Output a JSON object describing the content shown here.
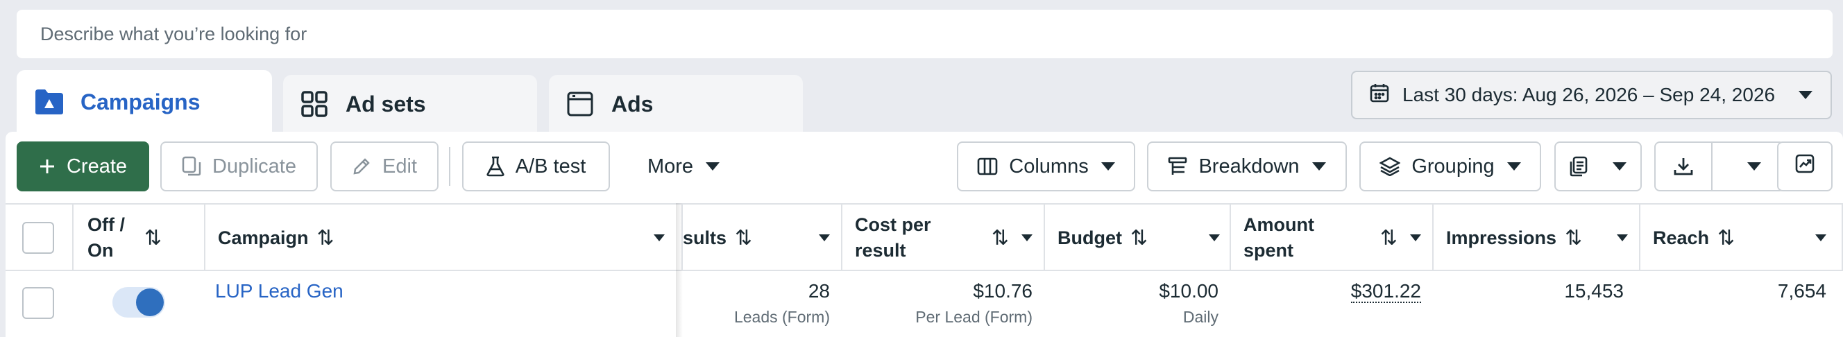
{
  "search": {
    "placeholder": "Describe what you’re looking for"
  },
  "tabs": [
    {
      "label": "Campaigns",
      "icon": "folder-icon"
    },
    {
      "label": "Ad sets",
      "icon": "grid-icon"
    },
    {
      "label": "Ads",
      "icon": "ad-icon"
    }
  ],
  "date_range": {
    "label": "Last 30 days: Aug 26, 2026 – Sep 24, 2026",
    "icon": "calendar-icon"
  },
  "toolbar": {
    "create": "Create",
    "duplicate": "Duplicate",
    "edit": "Edit",
    "ab_test": "A/B test",
    "more": "More",
    "columns": "Columns",
    "breakdown": "Breakdown",
    "grouping": "Grouping"
  },
  "table": {
    "headers": {
      "off_on_1": "Off /",
      "off_on_2": "On",
      "campaign": "Campaign",
      "results": "sults",
      "cost_per_result_1": "Cost per",
      "cost_per_result_2": "result",
      "budget": "Budget",
      "amount_spent_1": "Amount",
      "amount_spent_2": "spent",
      "impressions": "Impressions",
      "reach": "Reach"
    },
    "rows": [
      {
        "campaign": "LUP Lead Gen",
        "results": "28",
        "results_sub": "Leads (Form)",
        "cost_per_result": "$10.76",
        "cost_sub": "Per Lead (Form)",
        "budget": "$10.00",
        "budget_sub": "Daily",
        "amount_spent": "$301.22",
        "impressions": "15,453",
        "reach": "7,654",
        "enabled": true
      }
    ]
  },
  "colors": {
    "primary": "#2f6e4a",
    "link": "#2764c5",
    "toggle_on": "#2f6fbe"
  }
}
